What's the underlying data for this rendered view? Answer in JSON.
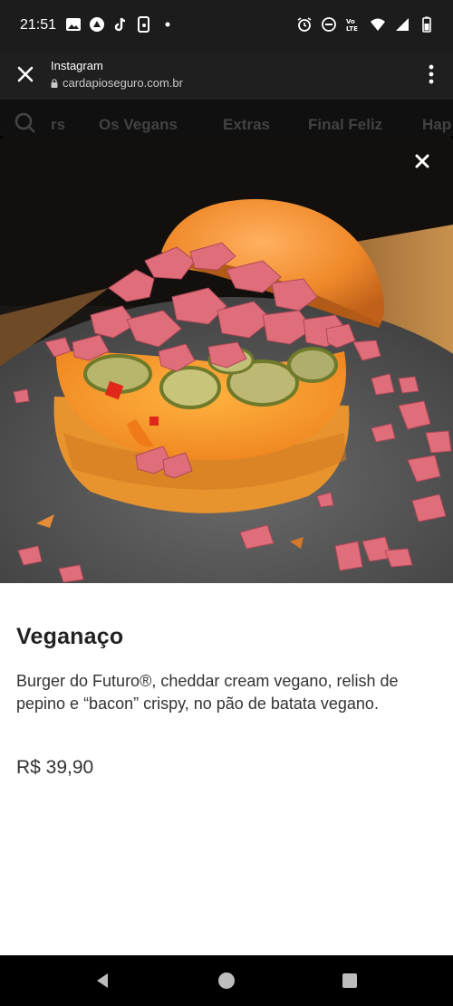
{
  "status_bar": {
    "time": "21:51",
    "left_icons": [
      "gallery-icon",
      "cast-icon",
      "tiktok-icon",
      "app-icon",
      "dot-icon"
    ],
    "right_icons": [
      "alarm-icon",
      "dnd-icon",
      "volte-icon",
      "wifi-icon",
      "signal-icon",
      "battery-icon"
    ]
  },
  "tab_bar": {
    "title": "Instagram",
    "url": "cardapioseguro.com.br"
  },
  "categories": {
    "items": [
      "rs",
      "Os Vegans",
      "Extras",
      "Final Feliz",
      "Hap"
    ]
  },
  "modal": {
    "image_alt": "Veganaço burger photo",
    "title": "Veganaço",
    "description": "Burger do Futuro®, cheddar cream vegano, relish de pepino e “bacon” crispy, no pão de batata vegano.",
    "price": "R$ 39,90"
  },
  "colors": {
    "bun": "#f08a2a",
    "cheese": "#f7a030",
    "bacon": "#e0707a",
    "plate": "#5a5a5a"
  }
}
